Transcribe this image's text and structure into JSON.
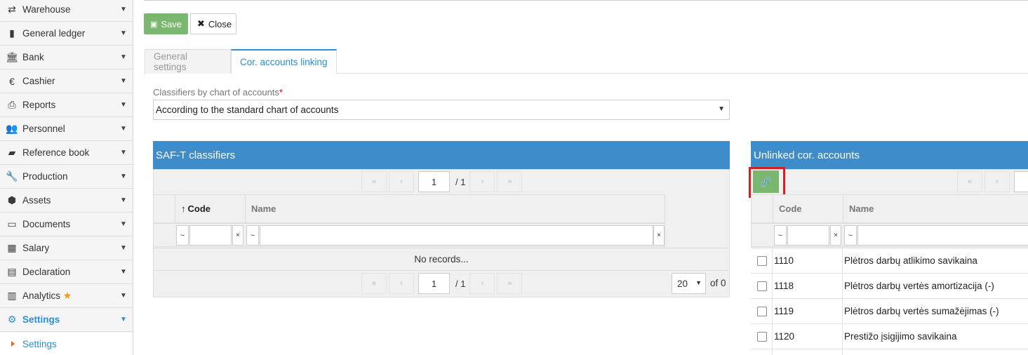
{
  "sidebar": {
    "items": [
      {
        "label": "Warehouse",
        "icon": "arrows-exchange-icon"
      },
      {
        "label": "General ledger",
        "icon": "book-icon"
      },
      {
        "label": "Bank",
        "icon": "bank-icon"
      },
      {
        "label": "Cashier",
        "icon": "euro-icon"
      },
      {
        "label": "Reports",
        "icon": "printer-icon"
      },
      {
        "label": "Personnel",
        "icon": "users-icon"
      },
      {
        "label": "Reference book",
        "icon": "folder-open-icon"
      },
      {
        "label": "Production",
        "icon": "wrench-icon"
      },
      {
        "label": "Assets",
        "icon": "cube-icon"
      },
      {
        "label": "Documents",
        "icon": "inbox-icon"
      },
      {
        "label": "Salary",
        "icon": "table-icon"
      },
      {
        "label": "Declaration",
        "icon": "file-text-icon"
      },
      {
        "label": "Analytics",
        "icon": "bar-chart-icon"
      },
      {
        "label": "Settings",
        "icon": "gears-icon"
      }
    ],
    "sub_item": "Settings"
  },
  "toolbar": {
    "save_label": "Save",
    "close_label": "Close"
  },
  "tabs": [
    {
      "label": "General settings",
      "active": false
    },
    {
      "label": "Cor. accounts linking",
      "active": true
    }
  ],
  "classifier_field": {
    "label": "Classifiers by chart of accounts",
    "required_mark": "*",
    "value": "According to the standard chart of accounts"
  },
  "saft_panel": {
    "title": "SAF-T classifiers",
    "page": "1",
    "page_total": "/ 1",
    "columns": {
      "code": "Code",
      "name": "Name",
      "sort_icon": "sort-asc-icon"
    },
    "filter_tilde": "~",
    "filter_clear": "×",
    "empty_text": "No records...",
    "page_size": "20",
    "total_text": "of 0"
  },
  "unlinked_panel": {
    "title": "Unlinked cor. accounts",
    "link_icon": "link-icon",
    "columns": {
      "code": "Code",
      "name": "Name"
    },
    "filter_tilde": "~",
    "filter_clear": "×",
    "rows": [
      {
        "code": "1110",
        "name": "Plėtros darbų atlikimo savikaina"
      },
      {
        "code": "1118",
        "name": "Plėtros darbų vertės amortizacija (-)"
      },
      {
        "code": "1119",
        "name": "Plėtros darbų vertės sumažėjimas (-)"
      },
      {
        "code": "1120",
        "name": "Prestižo įsigijimo savikaina"
      }
    ]
  },
  "colors": {
    "accent": "#3f8ccb",
    "save_green": "#7bb86f",
    "active_blue": "#2b8fd6",
    "highlight_red": "#d32020",
    "star_orange": "#f39c12"
  }
}
